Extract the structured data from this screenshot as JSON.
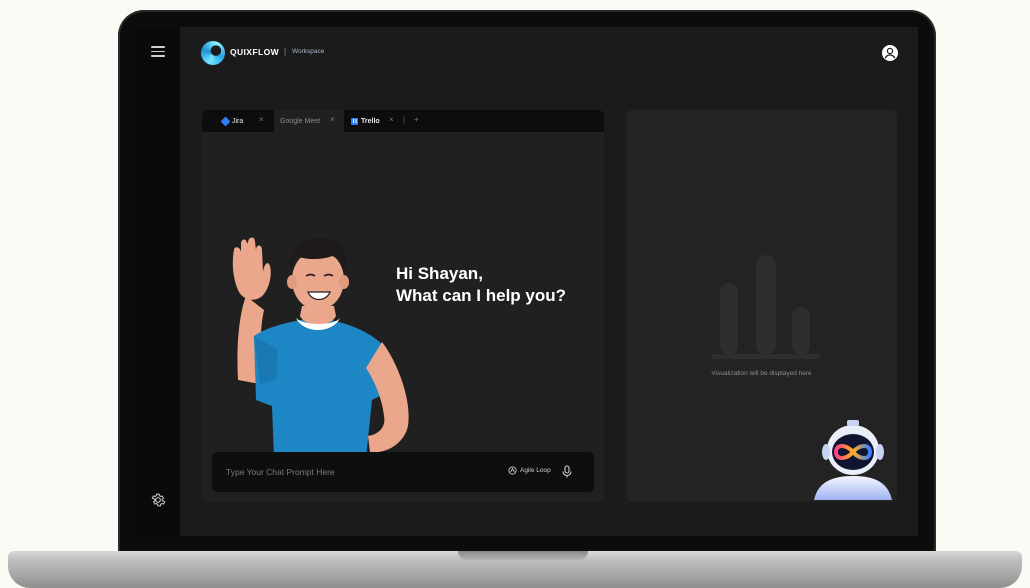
{
  "app": {
    "brand": "QUIXFLOW",
    "separator": "|",
    "section": "Workspace"
  },
  "tabs": [
    {
      "label": "Jira",
      "icon": "jira-icon",
      "active": false
    },
    {
      "label": "Google Meet",
      "icon": "",
      "active": true
    },
    {
      "label": "Trello",
      "icon": "trello-icon",
      "active": false
    }
  ],
  "tab_close_glyph": "×",
  "tab_more_glyph": "+",
  "chat": {
    "greeting_line1": "Hi Shayan,",
    "greeting_line2": "What can I help you?",
    "prompt_placeholder": "Type Your Chat Prompt Here",
    "agile_label": "Agile Loop"
  },
  "visualization": {
    "placeholder_text": "Visualization will be displayed here"
  },
  "colors": {
    "accent": "#2f7cf6",
    "brand_gradient_start": "#6fe7ff",
    "brand_gradient_end": "#1e8fd6",
    "screen_bg": "#1b1b1b",
    "panel_bg": "#202020"
  },
  "icons": [
    "menu-icon",
    "logo-icon",
    "profile-icon",
    "settings-icon",
    "jira-icon",
    "trello-icon",
    "agile-loop-icon",
    "mic-icon",
    "bot-icon",
    "chart-icon"
  ]
}
